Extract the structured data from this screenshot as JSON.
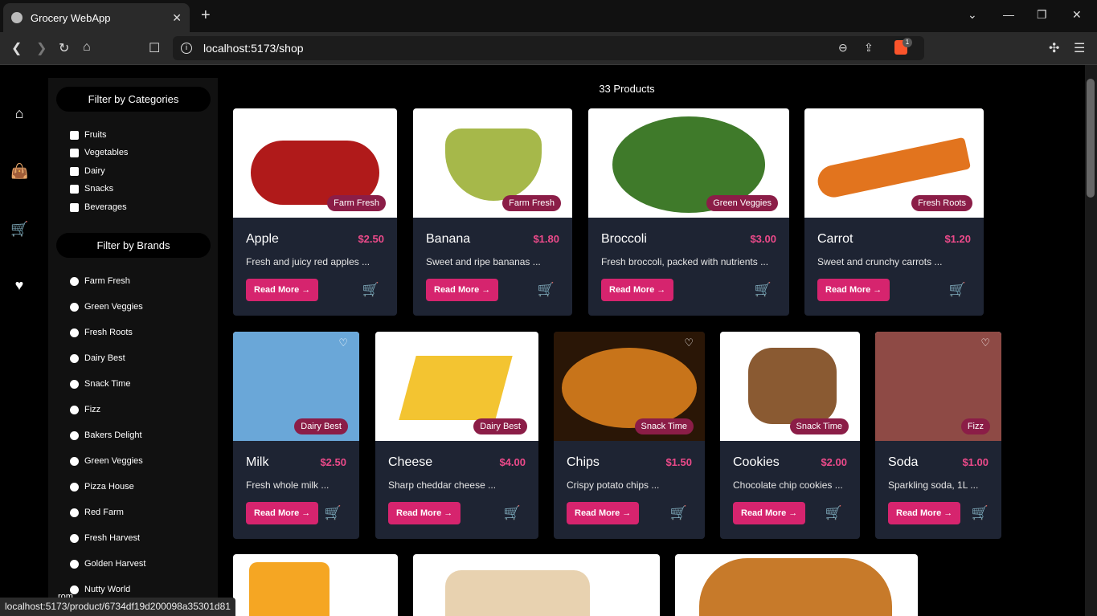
{
  "browser": {
    "tab_title": "Grocery WebApp",
    "url": "localhost:5173/shop",
    "brave_count": "1",
    "status_url": "localhost:5173/product/6734df19d200098a35301d81"
  },
  "sidebar": {
    "categories_title": "Filter by Categories",
    "categories": [
      "Fruits",
      "Vegetables",
      "Dairy",
      "Snacks",
      "Beverages"
    ],
    "brands_title": "Filter by Brands",
    "brands": [
      "Farm Fresh",
      "Green Veggies",
      "Fresh Roots",
      "Dairy Best",
      "Snack Time",
      "Fizz",
      "Bakers Delight",
      "Green Veggies",
      "Pizza House",
      "Red Farm",
      "Fresh Harvest",
      "Golden Harvest",
      "Nutty World"
    ],
    "partial_text": "rom"
  },
  "main": {
    "count": "33 Products",
    "read_more": "Read More",
    "products": [
      {
        "name": "Apple",
        "price": "$2.50",
        "desc": "Fresh and juicy red apples ...",
        "brand": "Farm Fresh",
        "color": "#b01a1a"
      },
      {
        "name": "Banana",
        "price": "$1.80",
        "desc": "Sweet and ripe bananas ...",
        "brand": "Farm Fresh",
        "color": "#a6b84a"
      },
      {
        "name": "Broccoli",
        "price": "$3.00",
        "desc": "Fresh broccoli, packed with nutrients ...",
        "brand": "Green Veggies",
        "color": "#3f7a2a"
      },
      {
        "name": "Carrot",
        "price": "$1.20",
        "desc": "Sweet and crunchy carrots ...",
        "brand": "Fresh Roots",
        "color": "#e2741e"
      },
      {
        "name": "Milk",
        "price": "$2.50",
        "desc": "Fresh whole milk ...",
        "brand": "Dairy Best",
        "color": "#6aa7d8"
      },
      {
        "name": "Cheese",
        "price": "$4.00",
        "desc": "Sharp cheddar cheese ...",
        "brand": "Dairy Best",
        "color": "#f3c431"
      },
      {
        "name": "Chips",
        "price": "$1.50",
        "desc": "Crispy potato chips ...",
        "brand": "Snack Time",
        "color": "#c8741a"
      },
      {
        "name": "Cookies",
        "price": "$2.00",
        "desc": "Chocolate chip cookies ...",
        "brand": "Snack Time",
        "color": "#8a5a32"
      },
      {
        "name": "Soda",
        "price": "$1.00",
        "desc": "Sparkling soda, 1L ...",
        "brand": "Fizz",
        "color": "#8e4a45"
      }
    ],
    "partial_colors": [
      "#f5a623",
      "#e8d2b0",
      "#c77a2a"
    ]
  },
  "icons": {
    "home": "home-icon",
    "bag": "bag-icon",
    "cart": "cart-icon",
    "heart": "heart-icon"
  }
}
